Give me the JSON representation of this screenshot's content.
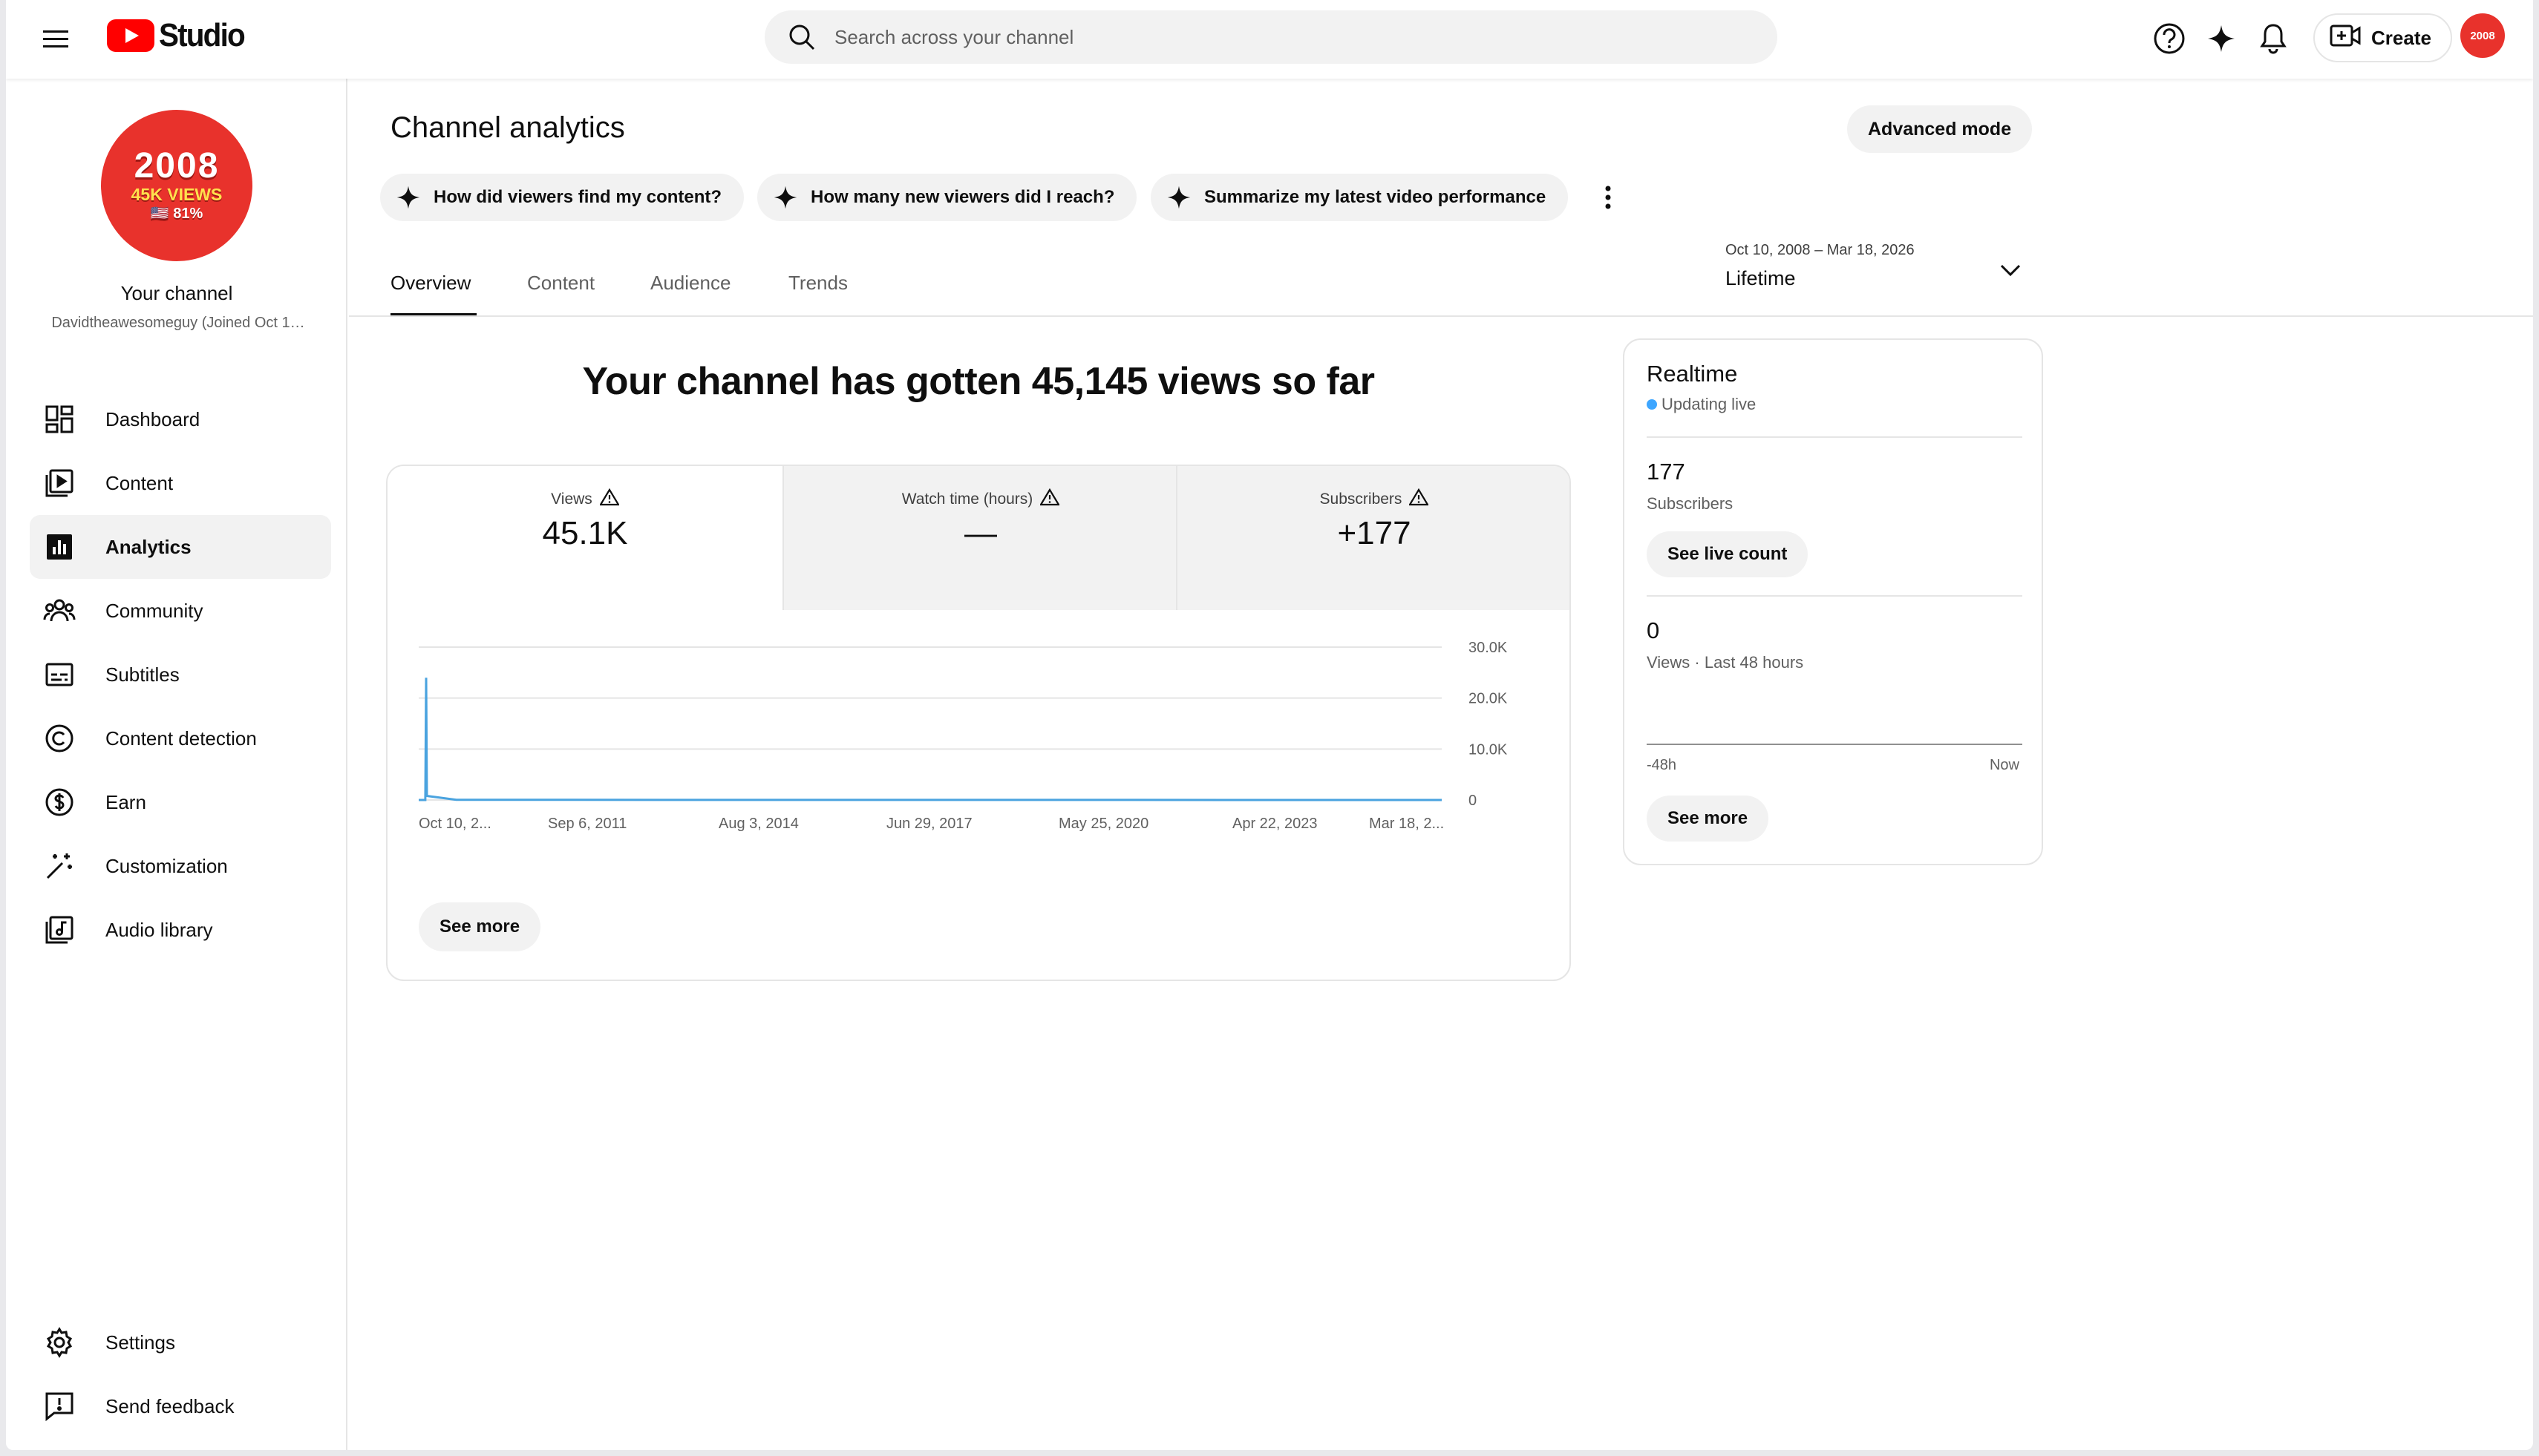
{
  "header": {
    "logo_text": "Studio",
    "search_placeholder": "Search across your channel",
    "create_label": "Create",
    "avatar_text": "2008"
  },
  "sidebar": {
    "avatar": {
      "year": "2008",
      "views": "45K VIEWS",
      "pct": "🇺🇸 81%"
    },
    "channel_title": "Your channel",
    "channel_handle": "Davidtheawesomeguy (Joined Oct 1…",
    "items": [
      {
        "label": "Dashboard",
        "icon": "dashboard-icon"
      },
      {
        "label": "Content",
        "icon": "content-icon"
      },
      {
        "label": "Analytics",
        "icon": "analytics-icon",
        "active": true
      },
      {
        "label": "Community",
        "icon": "community-icon"
      },
      {
        "label": "Subtitles",
        "icon": "subtitles-icon"
      },
      {
        "label": "Content detection",
        "icon": "copyright-icon"
      },
      {
        "label": "Earn",
        "icon": "dollar-icon"
      },
      {
        "label": "Customization",
        "icon": "magic-wand-icon"
      },
      {
        "label": "Audio library",
        "icon": "audio-library-icon"
      }
    ],
    "bottom_items": [
      {
        "label": "Settings",
        "icon": "gear-icon"
      },
      {
        "label": "Send feedback",
        "icon": "feedback-icon"
      }
    ]
  },
  "main": {
    "title": "Channel analytics",
    "advanced_mode": "Advanced mode",
    "chips": [
      "How did viewers find my content?",
      "How many new viewers did I reach?",
      "Summarize my latest video performance"
    ],
    "tabs": [
      "Overview",
      "Content",
      "Audience",
      "Trends"
    ],
    "date_range": "Oct 10, 2008 – Mar 18, 2026",
    "date_preset": "Lifetime",
    "headline": "Your channel has gotten 45,145 views so far",
    "metrics": [
      {
        "label": "Views",
        "value": "45.1K"
      },
      {
        "label": "Watch time (hours)",
        "value": "—"
      },
      {
        "label": "Subscribers",
        "value": "+177"
      }
    ],
    "see_more": "See more"
  },
  "chart_data": {
    "type": "line",
    "title": "",
    "series": [
      {
        "values": [
          {
            "x": "2008-10-10",
            "y": 0
          },
          {
            "x": "2008-11-20",
            "y": 0
          },
          {
            "x": "2008-11-25",
            "y": 24000
          },
          {
            "x": "2008-11-30",
            "y": 800
          },
          {
            "x": "2009-06-01",
            "y": 50
          },
          {
            "x": "2014-01-01",
            "y": 20
          },
          {
            "x": "2020-01-01",
            "y": 10
          },
          {
            "x": "2026-03-18",
            "y": 5
          }
        ],
        "color": "#4aa3df"
      }
    ],
    "x_tick_labels": [
      "Oct 10, 2...",
      "Sep 6, 2011",
      "Aug 3, 2014",
      "Jun 29, 2017",
      "May 25, 2020",
      "Apr 22, 2023",
      "Mar 18, 2..."
    ],
    "y_tick_labels": [
      "30.0K",
      "20.0K",
      "10.0K",
      "0"
    ],
    "ylim": [
      0,
      30000
    ],
    "grid": true
  },
  "realtime": {
    "title": "Realtime",
    "status": "Updating live",
    "subscribers_value": "177",
    "subscribers_label": "Subscribers",
    "see_live_count": "See live count",
    "views_value": "0",
    "views_label": "Views · Last 48 hours",
    "axis_left": "-48h",
    "axis_right": "Now",
    "see_more": "See more",
    "status_color": "#3ea6ff"
  }
}
